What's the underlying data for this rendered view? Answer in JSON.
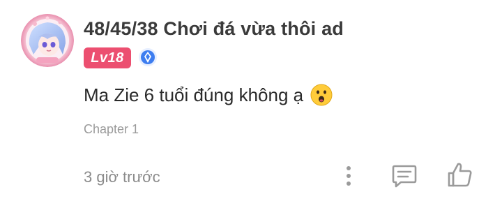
{
  "comment": {
    "username": "48/45/38 Chơi đá vừa thôi ad",
    "level_badge": "Lv18",
    "text": "Ma Zie 6 tuổi đúng không ạ",
    "emoji": "surprised-face-icon",
    "chapter": "Chapter 1",
    "timestamp": "3 giờ trước"
  },
  "icons": {
    "verified": "verified-badge-icon",
    "more": "more-vertical-icon",
    "reply": "comment-icon",
    "like": "thumbs-up-icon"
  },
  "colors": {
    "level_badge": "#ec4f70",
    "verified": "#3d7df0",
    "muted_text": "#9a9a9a",
    "icon_gray": "#9a9a9a",
    "username": "#3a3a3a"
  }
}
